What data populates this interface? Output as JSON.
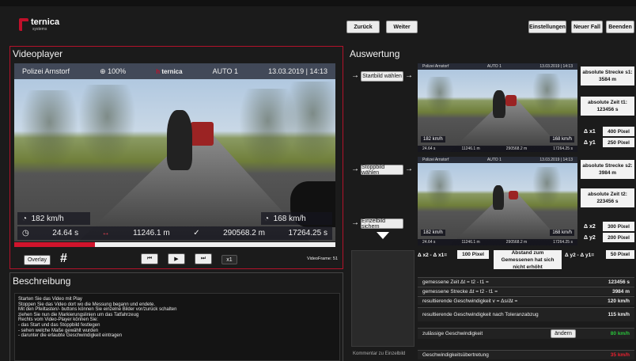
{
  "header": {
    "logo_name": "ternica",
    "logo_sub": "systems",
    "back_label": "Zurück",
    "next_label": "Weiter",
    "settings_label": "Einstellungen",
    "newcase_label": "Neuer Fall",
    "exit_label": "Beenden"
  },
  "video": {
    "title": "Videoplayer",
    "source": "Polizei Arnstorf",
    "zoom": "100%",
    "mode": "AUTO 1",
    "datetime": "13.03.2019 | 14:13",
    "speed_left": "182 km/h",
    "time_left": "24.64 s",
    "distance": "11246.1 m",
    "position": "290568.2 m",
    "speed_right": "168 km/h",
    "time_right": "17264.25 s",
    "frame_label": "VideoFrame: 51",
    "speed_select": "x1",
    "overlay_label": "Overlay",
    "progress": 0.25
  },
  "description": {
    "title": "Beschreibung",
    "lines": [
      "Starten Sie das Video mit Play",
      "Stoppen Sie das Video dort wo die Messung begann und endete.",
      "Mit den Pfeiltasten/- buttons können Sie einzelne Bilder vor/zurück schalten",
      "ziehen Sie nun die Markierungslinien um das Tatfahrzeug",
      "Rechts vom Video-Player können Sie:",
      "- das Start und das Stoppbild festlegen",
      "- sehen welche Maße gewählt wurden",
      "- darunter die erlaubte Geschwindigkeit eintragen"
    ]
  },
  "evaluation": {
    "title": "Auswertung",
    "start_btn": "Startbild wählen",
    "stop_btn": "Stoppbild wählen",
    "save_btn": "Einzelbild sichern",
    "thumb1": {
      "source": "Polizei Arnstorf",
      "mode": "AUTO 1",
      "datetime": "13.03.2019 | 14:13",
      "speed_l": "182 km/h",
      "speed_r": "168 km/h",
      "time": "24.64 s",
      "dist": "11246.1 m",
      "pos": "290568.2 m",
      "time_r": "17264.25 s"
    },
    "thumb2": {
      "source": "Polizei Arnstorf",
      "mode": "AUTO 1",
      "datetime": "13.03.2019 | 14:13",
      "speed_l": "182 km/h",
      "speed_r": "168 km/h",
      "time": "24.64 s",
      "dist": "11246.1 m",
      "pos": "290568.2 m",
      "time_r": "17264.25 s"
    },
    "s1_label": "absolute Strecke s1:",
    "s1_value": "3584 m",
    "t1_label": "absolute Zeit t1:",
    "t1_value": "123456 s",
    "dx1_label": "Δ x1",
    "dx1_value": "400 Pixel",
    "dy1_label": "Δ y1",
    "dy1_value": "250 Pixel",
    "s2_label": "absolute Strecke s2:",
    "s2_value": "3984 m",
    "t2_label": "absolute Zeit t2:",
    "t2_value": "223456 s",
    "dx2_label": "Δ x2",
    "dx2_value": "300 Pixel",
    "dy2_label": "Δ y2",
    "dy2_value": "200 Pixel",
    "dxdiff_label": "Δ x2 - Δ x1=",
    "dxdiff_value": "100 Pixel",
    "dist_msg": "Abstand zum Gemessenen hat sich nicht erhöht",
    "dydiff_label": "Δ y2 - Δ y1=",
    "dydiff_value": "50 Pixel",
    "rows": [
      {
        "label": "gemessene Zeit Δt = t2 - t1 =",
        "value": "123456 s"
      },
      {
        "label": "gemessene Strecke Δt = t2 - t1 =",
        "value": "3984 m"
      },
      {
        "label": "resultierende Geschwindigkeit v = Δs/Δt =",
        "value": "120 km/h"
      }
    ],
    "tol_label": "resultierende Geschwindigkeit nach Toleranzabzug",
    "tol_value": "115 km/h",
    "allowed_label": "zulässige Geschwindigkeit",
    "change_btn": "ändern",
    "allowed_value": "80 km/h",
    "comment_label": "Kommentar zu Einzelbild",
    "violation_label": "Geschwindigkeitsübertretung",
    "violation_value": "35 km/h"
  }
}
